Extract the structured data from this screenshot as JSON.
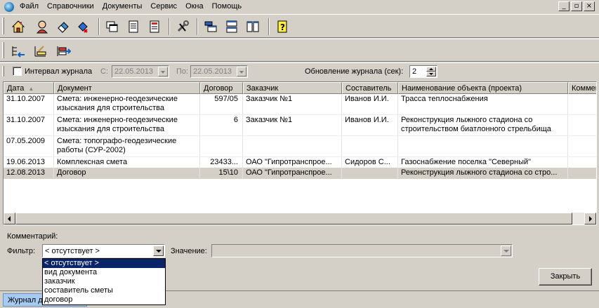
{
  "menu": [
    "Файл",
    "Справочники",
    "Документы",
    "Сервис",
    "Окна",
    "Помощь"
  ],
  "window_buttons": [
    "_",
    "▫",
    "×"
  ],
  "filterbar": {
    "interval_label": "Интервал журнала",
    "from_label": "С:",
    "from_value": "22.05.2013",
    "to_label": "По:",
    "to_value": "22.05.2013",
    "refresh_label": "Обновление журнала (сек):",
    "refresh_value": "2"
  },
  "grid": {
    "columns": [
      "Дата",
      "Документ",
      "Договор",
      "Заказчик",
      "Составитель",
      "Наименование объекта (проекта)",
      "Коммен"
    ],
    "sort_indicator": "▲",
    "rows": [
      {
        "date": "31.10.2007",
        "doc": [
          "Смета: инженерно-геодезические",
          "изыскания для строительства"
        ],
        "contract": "597/05",
        "customer": "Заказчик №1",
        "author": "Иванов И.И.",
        "object": [
          "Трасса теплоснабжения"
        ],
        "comment": ""
      },
      {
        "date": "31.10.2007",
        "doc": [
          "Смета: инженерно-геодезические",
          "изыскания для строительства"
        ],
        "contract": "6",
        "customer": "Заказчик №1",
        "author": "Иванов И.И.",
        "object": [
          "Реконструкция лыжного стадиона со",
          "строительством биатлонного стрельбища"
        ],
        "comment": ""
      },
      {
        "date": "07.05.2009",
        "doc": [
          "Смета: топографо-геодезические",
          "работы (СУР-2002)"
        ],
        "contract": "",
        "customer": "",
        "author": "",
        "object": [
          ""
        ],
        "comment": ""
      },
      {
        "date": "19.06.2013",
        "doc": [
          "Комплексная смета"
        ],
        "contract": "23433...",
        "customer": "ОАО \"Гипротранспрое...",
        "author": "Сидоров С...",
        "object": [
          "Газоснабжение поселка \"Северный\""
        ],
        "comment": ""
      },
      {
        "date": "12.08.2013",
        "doc": [
          "Договор"
        ],
        "contract": "15\\10",
        "customer": "ОАО \"Гипротранспрое...",
        "author": "",
        "object": [
          "Реконструкция лыжного стадиона со стро..."
        ],
        "comment": ""
      }
    ]
  },
  "bottom": {
    "comment_label": "Комментарий:",
    "filter_label": "Фильтр:",
    "filter_value": "< отсутствует >",
    "value_label": "Значение:",
    "close_label": "Закрыть",
    "status_tab": "Журнал документов"
  },
  "dropdown": [
    "< отсутствует >",
    "вид документа",
    "заказчик",
    "составитель сметы",
    "договор"
  ]
}
